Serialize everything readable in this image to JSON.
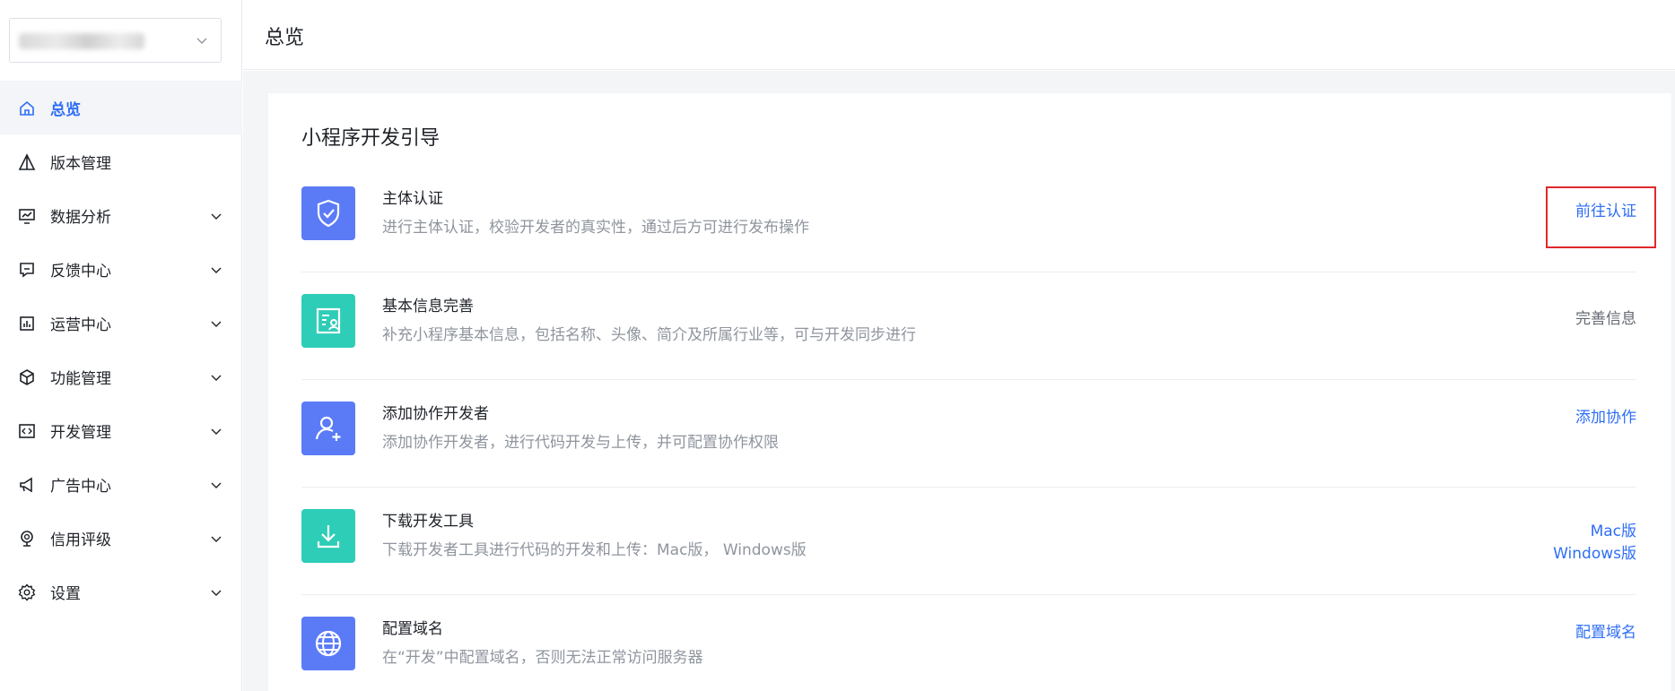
{
  "header": {
    "title": "总览"
  },
  "sidebar": {
    "items": [
      {
        "label": "总览",
        "icon": "home-icon",
        "active": true,
        "expandable": false
      },
      {
        "label": "版本管理",
        "icon": "version-icon",
        "active": false,
        "expandable": false
      },
      {
        "label": "数据分析",
        "icon": "chart-monitor-icon",
        "active": false,
        "expandable": true
      },
      {
        "label": "反馈中心",
        "icon": "feedback-icon",
        "active": false,
        "expandable": true
      },
      {
        "label": "运营中心",
        "icon": "operations-icon",
        "active": false,
        "expandable": true
      },
      {
        "label": "功能管理",
        "icon": "cube-icon",
        "active": false,
        "expandable": true
      },
      {
        "label": "开发管理",
        "icon": "code-icon",
        "active": false,
        "expandable": true
      },
      {
        "label": "广告中心",
        "icon": "megaphone-icon",
        "active": false,
        "expandable": true
      },
      {
        "label": "信用评级",
        "icon": "badge-icon",
        "active": false,
        "expandable": true
      },
      {
        "label": "设置",
        "icon": "gear-icon",
        "active": false,
        "expandable": true
      }
    ]
  },
  "guide": {
    "title": "小程序开发引导",
    "rows": [
      {
        "name": "主体认证",
        "desc": "进行主体认证，校验开发者的真实性，通过后方可进行发布操作",
        "action": "前往认证",
        "icon": "shield-check-icon",
        "icon_color": "#5b7bf6"
      },
      {
        "name": "基本信息完善",
        "desc": "补充小程序基本信息，包括名称、头像、简介及所属行业等，可与开发同步进行",
        "action": "完善信息",
        "icon": "profile-doc-icon",
        "icon_color": "#2ecdb8"
      },
      {
        "name": "添加协作开发者",
        "desc": "添加协作开发者，进行代码开发与上传，并可配置协作权限",
        "action": "添加协作",
        "icon": "add-user-icon",
        "icon_color": "#5b7bf6"
      },
      {
        "name": "下载开发工具",
        "desc": "下载开发者工具进行代码的开发和上传：Mac版， Windows版",
        "action": "Mac版",
        "action2": "Windows版",
        "icon": "download-icon",
        "icon_color": "#2ecdb8"
      },
      {
        "name": "配置域名",
        "desc": "在“开发”中配置域名，否则无法正常访问服务器",
        "action": "配置域名",
        "icon": "globe-icon",
        "icon_color": "#5b7bf6"
      }
    ]
  },
  "colors": {
    "accent": "#2f6ef6",
    "highlight_box": "#e0292c"
  }
}
